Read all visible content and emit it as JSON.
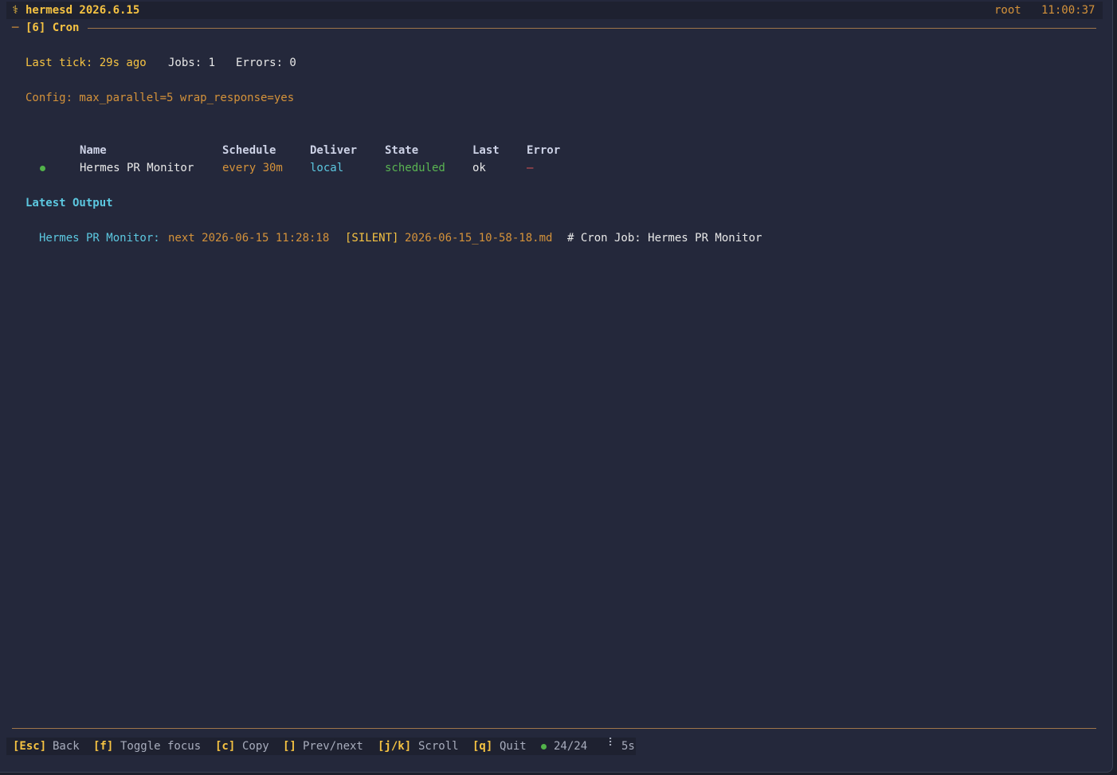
{
  "titlebar": {
    "icon": "⚕",
    "app_title": "hermesd 2026.6.15",
    "user": "root",
    "clock": "11:00:37"
  },
  "panel": {
    "dash": "─",
    "title": "[6] Cron"
  },
  "status": {
    "last_tick": "Last tick: 29s ago",
    "jobs": "Jobs: 1",
    "errors": "Errors: 0"
  },
  "config": {
    "text": "Config: max_parallel=5 wrap_response=yes"
  },
  "table": {
    "headers": {
      "name": "Name",
      "schedule": "Schedule",
      "deliver": "Deliver",
      "state": "State",
      "last": "Last",
      "error": "Error"
    },
    "rows": [
      {
        "name": "Hermes PR Monitor",
        "schedule": "every 30m",
        "deliver": "local",
        "state": "scheduled",
        "last": "ok",
        "error": "—",
        "status_color": "#52b34a"
      }
    ]
  },
  "latest_output": {
    "heading": "Latest Output",
    "job_label": "Hermes PR Monitor:",
    "next_run": "next 2026-06-15 11:28:18",
    "silent_tag": "[SILENT]",
    "file_name": "2026-06-15_10-58-18.md",
    "content": "# Cron Job: Hermes PR Monitor"
  },
  "footer": {
    "esc_key": "[Esc]",
    "esc_label": "Back",
    "f_key": "[f]",
    "f_label": "Toggle focus",
    "c_key": "[c]",
    "c_label": "Copy",
    "bracket_key": "[]",
    "bracket_label": "Prev/next",
    "jk_key": "[j/k]",
    "jk_label": "Scroll",
    "q_key": "[q]",
    "q_label": "Quit",
    "counter": "24/24",
    "spinner": "⠇",
    "interval": "5s"
  },
  "colors": {
    "background": "#24283b",
    "accent_yellow": "#f6c342",
    "accent_orange": "#d4923a",
    "cyan": "#5cc8e0",
    "green": "#5ab552",
    "rule": "#a0764a"
  }
}
